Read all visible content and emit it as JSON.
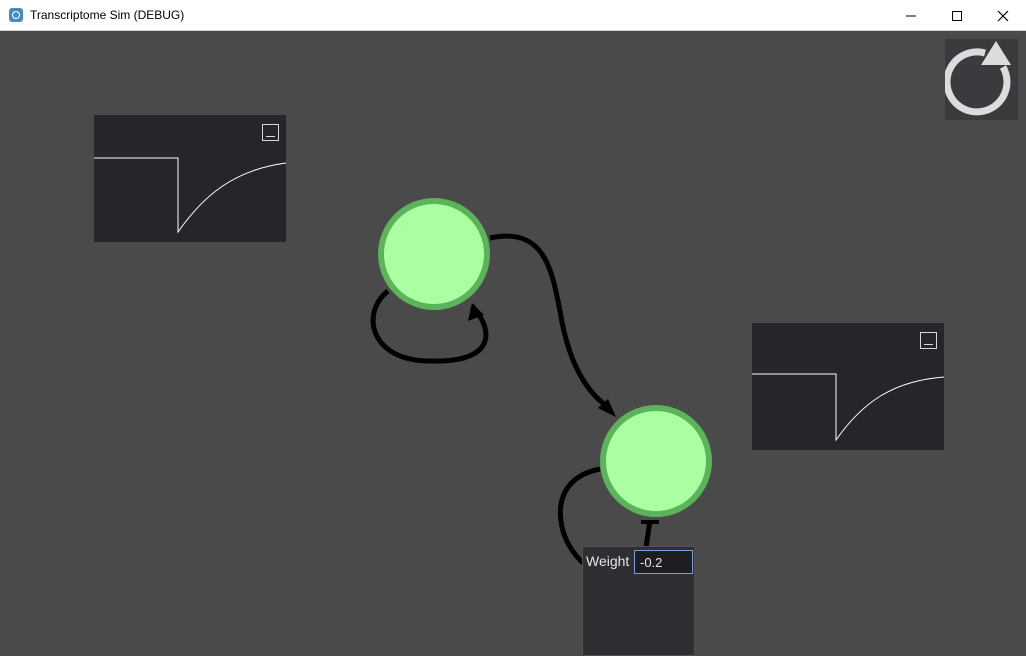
{
  "window": {
    "title": "Transcriptome Sim (DEBUG)",
    "app_icon": "godot-icon",
    "controls": [
      "minimize-icon",
      "maximize-icon",
      "close-icon"
    ]
  },
  "canvas": {
    "background": "#4a4a4a",
    "node_fill": "#aaffa2",
    "node_border": "#5cb35c",
    "edge_color": "#000000"
  },
  "nodes": [
    {
      "id": "gene-1",
      "label": ""
    },
    {
      "id": "gene-2",
      "label": ""
    }
  ],
  "edges": [
    {
      "from": "gene-1",
      "to": "gene-1",
      "type": "activation"
    },
    {
      "from": "gene-1",
      "to": "gene-2",
      "type": "activation"
    },
    {
      "from": "gene-2",
      "to": "gene-2",
      "type": "repression"
    }
  ],
  "reset_button": {
    "icon": "reload-icon"
  },
  "weight_popup": {
    "label": "Weight",
    "value": "-0.2"
  }
}
